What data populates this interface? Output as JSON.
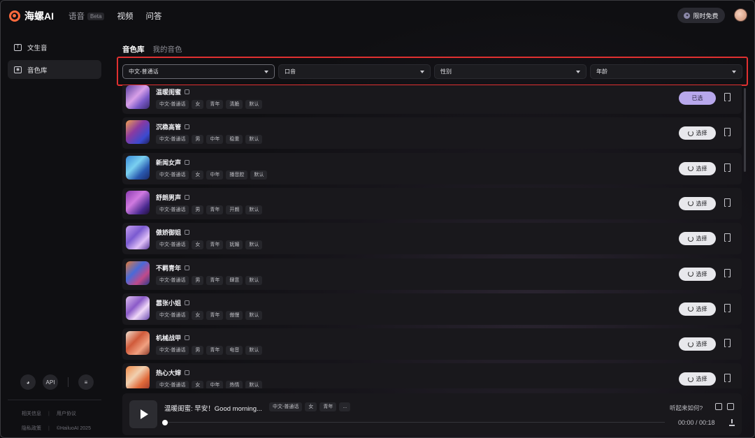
{
  "header": {
    "logo_text": "海螺AI",
    "nav": [
      {
        "label": "语音",
        "badge": "Beta"
      },
      {
        "label": "视频"
      },
      {
        "label": "问答"
      }
    ],
    "promo_label": "限时免费"
  },
  "sidebar": {
    "items": [
      {
        "label": "文生音"
      },
      {
        "label": "音色库"
      }
    ],
    "bottom_api_label": "API",
    "footer_links": [
      "相关信息",
      "用户协议",
      "隐私政策",
      "©HailuoAI 2025"
    ]
  },
  "main": {
    "tabs": [
      {
        "label": "音色库"
      },
      {
        "label": "我的音色"
      }
    ],
    "filters": [
      {
        "value": "中文-普通话"
      },
      {
        "value": "口音"
      },
      {
        "value": "性别"
      },
      {
        "value": "年龄"
      }
    ],
    "voices": [
      {
        "name": "温暖闺蜜",
        "tags": [
          "中文-普通话",
          "女",
          "青年",
          "清脆",
          "默认"
        ],
        "action": "已选"
      },
      {
        "name": "沉稳高管",
        "tags": [
          "中文-普通话",
          "男",
          "中年",
          "稳重",
          "默认"
        ],
        "action": "选择"
      },
      {
        "name": "新闻女声",
        "tags": [
          "中文-普通话",
          "女",
          "中年",
          "播音腔",
          "默认"
        ],
        "action": "选择"
      },
      {
        "name": "舒朗男声",
        "tags": [
          "中文-普通话",
          "男",
          "青年",
          "开朗",
          "默认"
        ],
        "action": "选择"
      },
      {
        "name": "傲娇御姐",
        "tags": [
          "中文-普通话",
          "女",
          "青年",
          "妩媚",
          "默认"
        ],
        "action": "选择"
      },
      {
        "name": "不羁青年",
        "tags": [
          "中文-普通话",
          "男",
          "青年",
          "肆意",
          "默认"
        ],
        "action": "选择"
      },
      {
        "name": "嚣张小姐",
        "tags": [
          "中文-普通话",
          "女",
          "青年",
          "傲慢",
          "默认"
        ],
        "action": "选择"
      },
      {
        "name": "机械战甲",
        "tags": [
          "中文-普通话",
          "男",
          "青年",
          "电音",
          "默认"
        ],
        "action": "选择"
      },
      {
        "name": "热心大婶",
        "tags": [
          "中文-普通话",
          "女",
          "中年",
          "热情",
          "默认"
        ],
        "action": "选择"
      }
    ]
  },
  "player": {
    "title": "温暖闺蜜: 早安！Good morning...",
    "tags": [
      "中文-普通话",
      "女",
      "青年",
      "..."
    ],
    "question": "听起来如何?",
    "time": "00:00 / 00:18",
    "progress": 0
  },
  "colors": {
    "accent_selected": "#b8a8ec",
    "highlight_border": "#e03030"
  }
}
